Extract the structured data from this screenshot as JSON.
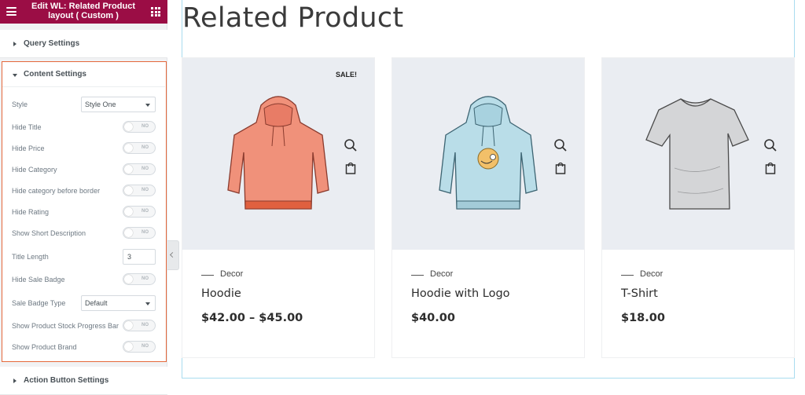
{
  "panel": {
    "title": "Edit WL: Related Product layout ( Custom )",
    "header_color": "#9b0d45"
  },
  "sections": {
    "query": "Query Settings",
    "content": "Content Settings",
    "action": "Action Button Settings"
  },
  "controls": {
    "style": {
      "label": "Style",
      "value": "Style One"
    },
    "hide_title": {
      "label": "Hide Title",
      "state": "NO"
    },
    "hide_price": {
      "label": "Hide Price",
      "state": "NO"
    },
    "hide_category": {
      "label": "Hide Category",
      "state": "NO"
    },
    "hide_category_border": {
      "label": "Hide category before border",
      "state": "NO"
    },
    "hide_rating": {
      "label": "Hide Rating",
      "state": "NO"
    },
    "show_short_desc": {
      "label": "Show Short Description",
      "state": "NO"
    },
    "title_length": {
      "label": "Title Length",
      "value": "3"
    },
    "hide_sale_badge": {
      "label": "Hide Sale Badge",
      "state": "NO"
    },
    "sale_badge_type": {
      "label": "Sale Badge Type",
      "value": "Default"
    },
    "show_stock_bar": {
      "label": "Show Product Stock Progress Bar",
      "state": "NO"
    },
    "show_brand": {
      "label": "Show Product Brand",
      "state": "NO"
    }
  },
  "preview": {
    "heading": "Related Product",
    "products": [
      {
        "badge": "SALE!",
        "category": "Decor",
        "name": "Hoodie",
        "price": "$42.00 – $45.00",
        "image": "hoodie-orange"
      },
      {
        "badge": "",
        "category": "Decor",
        "name": "Hoodie with Logo",
        "price": "$40.00",
        "image": "hoodie-blue-logo"
      },
      {
        "badge": "",
        "category": "Decor",
        "name": "T-Shirt",
        "price": "$18.00",
        "image": "tshirt-grey"
      }
    ]
  },
  "colors": {
    "accent_outline": "#e5683b",
    "preview_border": "#a9dcef",
    "image_bg": "#eaedf2"
  }
}
